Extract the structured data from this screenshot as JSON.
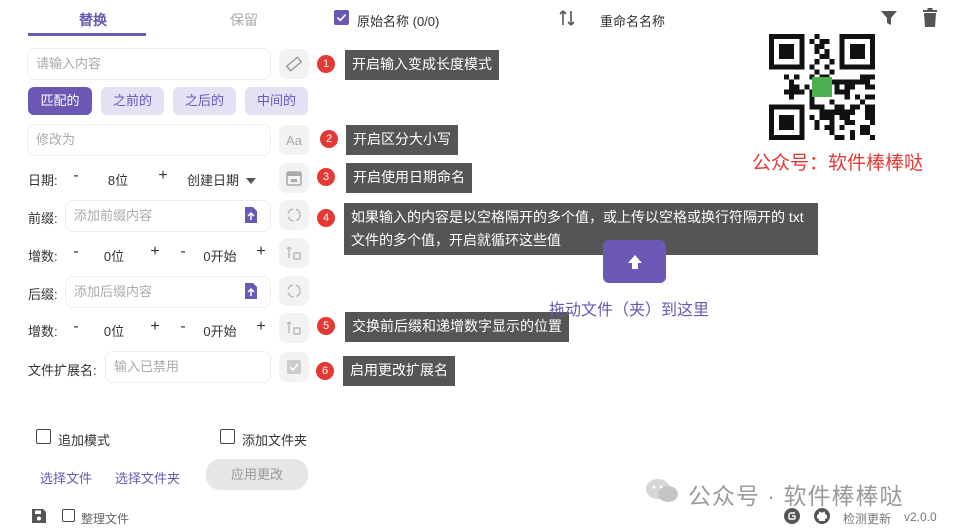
{
  "tabs": [
    {
      "label": "替换"
    },
    {
      "label": "保留"
    }
  ],
  "header": {
    "original_name": "原始名称 (0/0)",
    "rename_name": "重命名名称"
  },
  "replace": {
    "search_placeholder": "请输入内容",
    "modes": [
      "匹配的",
      "之前的",
      "之后的",
      "中间的"
    ],
    "replace_placeholder": "修改为"
  },
  "date": {
    "label": "日期:",
    "minus": "-",
    "value": "8位",
    "plus": "+",
    "type": "创建日期"
  },
  "prefix": {
    "label": "前缀:",
    "placeholder": "添加前缀内容"
  },
  "increment1": {
    "label": "增数:",
    "digits": "0位",
    "start": "0开始",
    "minus": "-",
    "plus": "+"
  },
  "suffix": {
    "label": "后缀:",
    "placeholder": "添加后缀内容"
  },
  "increment2": {
    "label": "增数:",
    "digits": "0位",
    "start": "0开始",
    "minus": "-",
    "plus": "+"
  },
  "extension": {
    "label": "文件扩展名:",
    "placeholder": "输入已禁用"
  },
  "tips": [
    {
      "num": "1",
      "text": "开启输入变成长度模式"
    },
    {
      "num": "2",
      "text": "开启区分大小写"
    },
    {
      "num": "3",
      "text": "开启使用日期命名"
    },
    {
      "num": "4",
      "text": "如果输入的内容是以空格隔开的多个值，或上传以空格或换行符隔开的 txt 文件的多个值，开启就循环这些值"
    },
    {
      "num": "5",
      "text": "交换前后缀和递增数字显示的位置"
    },
    {
      "num": "6",
      "text": "启用更改扩展名"
    }
  ],
  "options": {
    "append_mode": "追加模式",
    "add_folder": "添加文件夹"
  },
  "actions": {
    "select_files": "选择文件",
    "select_folder": "选择文件夹",
    "apply": "应用更改"
  },
  "footer": {
    "organize": "整理文件",
    "check_update": "检测更新",
    "version": "v2.0.0"
  },
  "drop": {
    "text": "拖动文件（夹）到这里"
  },
  "watermark": {
    "qr_caption": "公众号：软件棒棒哒",
    "bottom": "公众号 · 软件棒棒哒"
  },
  "colors": {
    "accent": "#6a58b4",
    "tip_bg": "#555555",
    "badge": "#e53935",
    "caption_red": "#e53935"
  }
}
